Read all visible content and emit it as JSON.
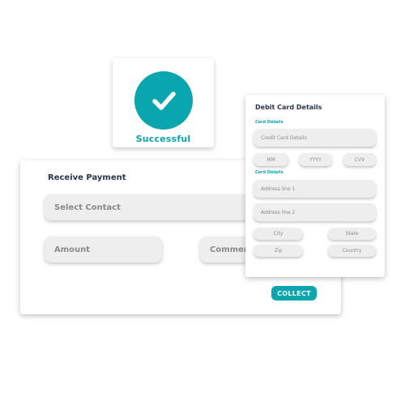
{
  "colors": {
    "accent": "#0aa6b0",
    "title_text": "#2c3550",
    "field_bg": "#eeeeee",
    "field_text": "#8a8a8a"
  },
  "success": {
    "icon": "check-icon",
    "label": "Successful"
  },
  "payment": {
    "title": "Receive Payment",
    "contact_placeholder": "Select Contact",
    "amount_placeholder": "Amount",
    "comment_placeholder": "Comment",
    "collect_label": "COLLECT"
  },
  "debit": {
    "title": "Debit Card Details",
    "card_section_label": "Card Details",
    "credit_card_placeholder": "Credit Card Details",
    "mm_placeholder": "MM",
    "yyyy_placeholder": "YYYY",
    "cvv_placeholder": "CVV",
    "address_section_label": "Card Details",
    "address1_placeholder": "Address line 1",
    "address2_placeholder": "Address line 2",
    "city_placeholder": "City",
    "state_placeholder": "State",
    "zip_placeholder": "Zip",
    "country_placeholder": "Country"
  }
}
